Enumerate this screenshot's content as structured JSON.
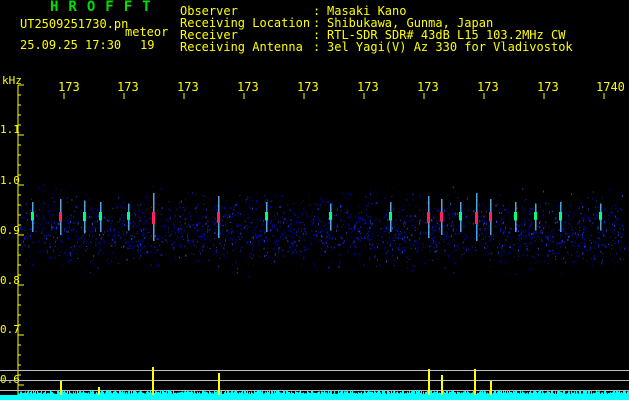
{
  "header": {
    "brand": "HROFFT",
    "filename": "UT2509251730.pn",
    "meteor_label": "meteor",
    "datetime": "25.09.25 17:30",
    "count": "19"
  },
  "info": [
    {
      "label": "Observer",
      "sep": ":",
      "value": "Masaki Kano"
    },
    {
      "label": "Receiving Location",
      "sep": ":",
      "value": "Shibukawa, Gunma, Japan"
    },
    {
      "label": "Receiver",
      "sep": ":",
      "value": "RTL-SDR SDR# 43dB L15 103.2MHz CW"
    },
    {
      "label": "Receiving Antenna",
      "sep": ":",
      "value": "3el Yagi(V) Az 330 for Vladivostok"
    }
  ],
  "axis": {
    "unit": "kHz",
    "y_ticks": [
      "1.1",
      "1.0",
      "0.9",
      "0.8",
      "0.7",
      "0.6"
    ],
    "x_ticks": [
      "173",
      "173",
      "173",
      "173",
      "173",
      "173",
      "173",
      "173",
      "173",
      "1740"
    ]
  },
  "colors": {
    "background": "#000000",
    "text": "#ffff00",
    "brand": "#00e000",
    "spectrum_noise": "#0000ff",
    "echo_hot": "#ff2060",
    "bottom_trace": "#00ffff"
  }
}
